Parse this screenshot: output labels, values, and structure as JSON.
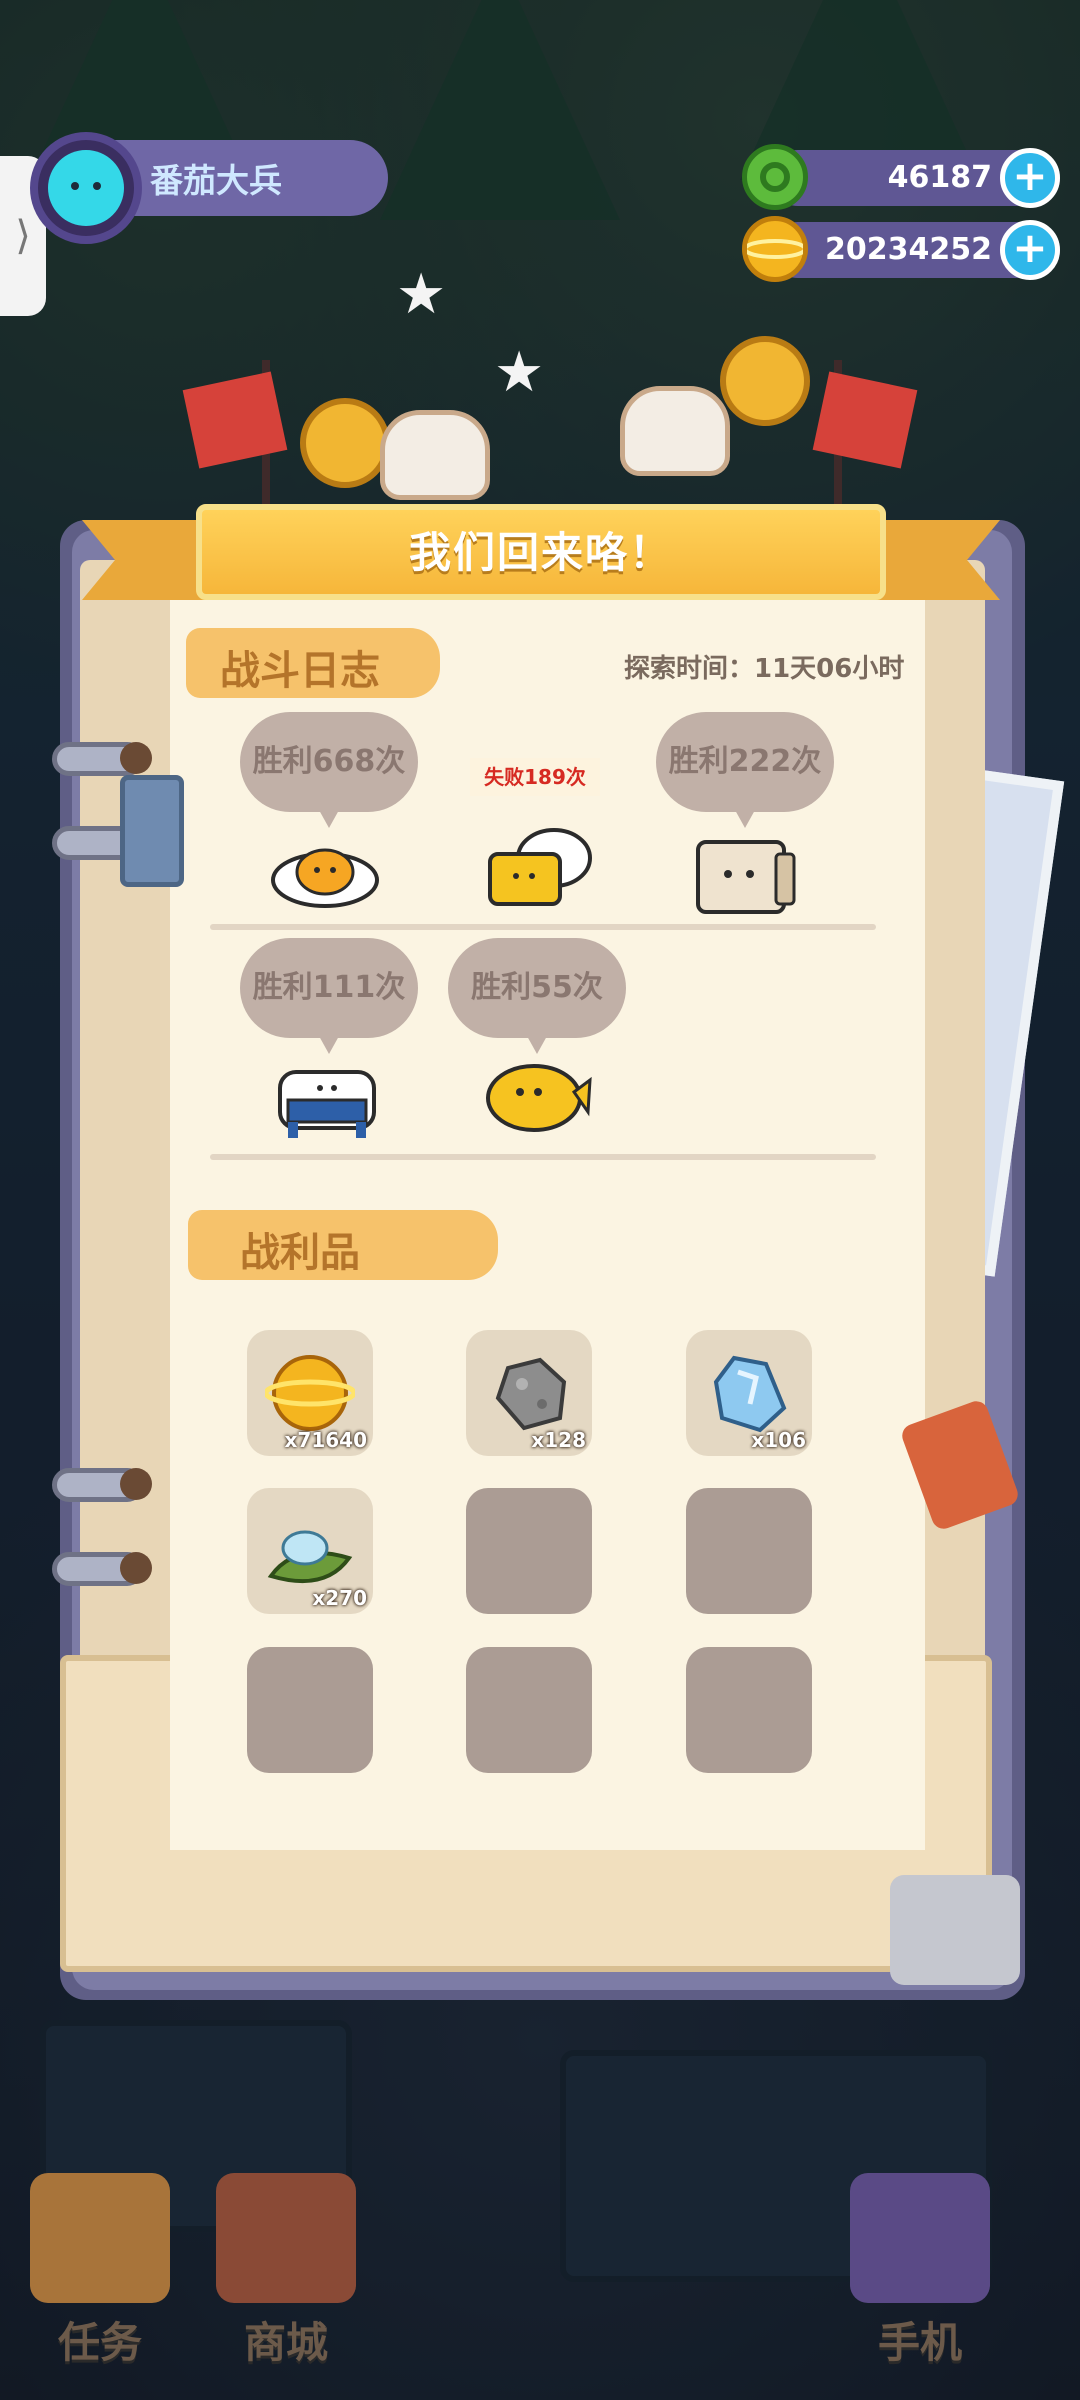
{
  "player": {
    "name": "番茄大兵"
  },
  "currencies": [
    {
      "name": "gems",
      "value": "46187",
      "color": "#5dbb3c"
    },
    {
      "name": "coins",
      "value": "20234252",
      "color": "#f4b51f"
    }
  ],
  "dialog": {
    "title": "我们回来咯！",
    "battle_log": {
      "title": "战斗日志",
      "explore_time": "探索时间：11天06小时",
      "entries": [
        {
          "result": "胜利668次",
          "monster": "egg-monster-icon"
        },
        {
          "result": "失败189次",
          "monster": "cheese-toast-monster-icon",
          "defeat": true
        },
        {
          "result": "胜利222次",
          "monster": "paper-bag-monster-icon"
        },
        {
          "result": "胜利111次",
          "monster": "cake-monster-icon"
        },
        {
          "result": "胜利55次",
          "monster": "fish-monster-icon"
        }
      ]
    },
    "loot": {
      "title": "战利品",
      "items": [
        {
          "icon": "gold-planet-coin-icon",
          "qty": "x71640"
        },
        {
          "icon": "stone-ore-icon",
          "qty": "x128"
        },
        {
          "icon": "ice-crystal-icon",
          "qty": "x106"
        },
        {
          "icon": "leaf-dewdrop-icon",
          "qty": "x270"
        }
      ],
      "slot_count": 9
    }
  },
  "dock": [
    {
      "label": "任务",
      "icon": "task-book-icon"
    },
    {
      "label": "商城",
      "icon": "shop-icon"
    },
    {
      "label": "手机",
      "icon": "phone-icon"
    }
  ],
  "colors": {
    "banner": "#f6b63a",
    "section_header": "#f6c26b",
    "page": "#fbf4e2",
    "defeat_text": "#d62a22",
    "accent_plus": "#2fb7ea"
  }
}
